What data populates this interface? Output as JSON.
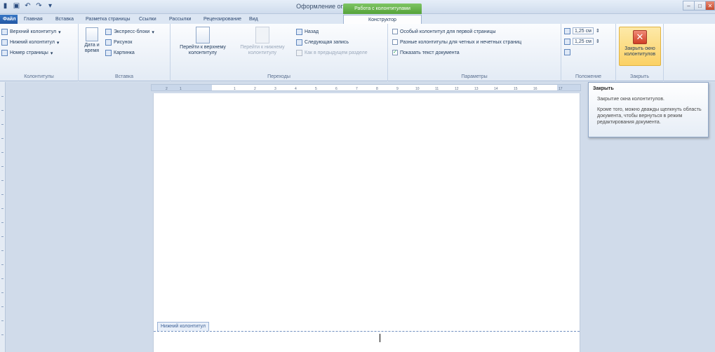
{
  "window": {
    "title": "Оформление оглавления - Microsoft Word",
    "context_tab_title": "Работа с колонтитулами"
  },
  "tabs": [
    {
      "label": "Файл"
    },
    {
      "label": "Главная"
    },
    {
      "label": "Вставка"
    },
    {
      "label": "Разметка страницы"
    },
    {
      "label": "Ссылки"
    },
    {
      "label": "Рассылки"
    },
    {
      "label": "Рецензирование"
    },
    {
      "label": "Вид"
    },
    {
      "label": "Конструктор"
    }
  ],
  "ribbon": {
    "headers_footers": {
      "header": "Верхний колонтитул",
      "footer": "Нижний колонтитул",
      "page_number": "Номер страницы",
      "group_label": "Колонтитулы"
    },
    "insert": {
      "date_time_line1": "Дата и",
      "date_time_line2": "время",
      "quick_parts": "Экспресс-блоки",
      "picture": "Рисунок",
      "clip_art": "Картинка",
      "group_label": "Вставка"
    },
    "navigation": {
      "goto_header_line1": "Перейти к верхнему",
      "goto_header_line2": "колонтитулу",
      "goto_footer_line1": "Перейти к нижнему",
      "goto_footer_line2": "колонтитулу",
      "previous": "Назад",
      "next": "Следующая запись",
      "link_previous": "Как в предыдущем разделе",
      "group_label": "Переходы"
    },
    "options": {
      "different_first": "Особый колонтитул для первой страницы",
      "different_odd_even": "Разные колонтитулы для четных и нечетных страниц",
      "show_doc_text": "Показать текст документа",
      "different_first_checked": false,
      "different_odd_even_checked": false,
      "show_doc_text_checked": true,
      "group_label": "Параметры"
    },
    "position": {
      "header_from_top": "1,25 см",
      "footer_from_bottom": "1,25 см",
      "group_label": "Положение"
    },
    "close": {
      "line1": "Закрыть окно",
      "line2": "колонтитулов",
      "group_label": "Закрыть"
    }
  },
  "ruler": {
    "ticks": [
      "1",
      "2",
      "1",
      "2",
      "3",
      "4",
      "5",
      "6",
      "7",
      "8",
      "9",
      "10",
      "11",
      "12",
      "13",
      "14",
      "15",
      "16",
      "17"
    ]
  },
  "document": {
    "footer_label": "Нижний колонтитул"
  },
  "tooltip": {
    "title": "Закрыть",
    "line1": "Закрытие окна колонтитулов.",
    "line2": "Кроме того, можно дважды щелкнуть область документа, чтобы вернуться в режим редактирования документа."
  }
}
